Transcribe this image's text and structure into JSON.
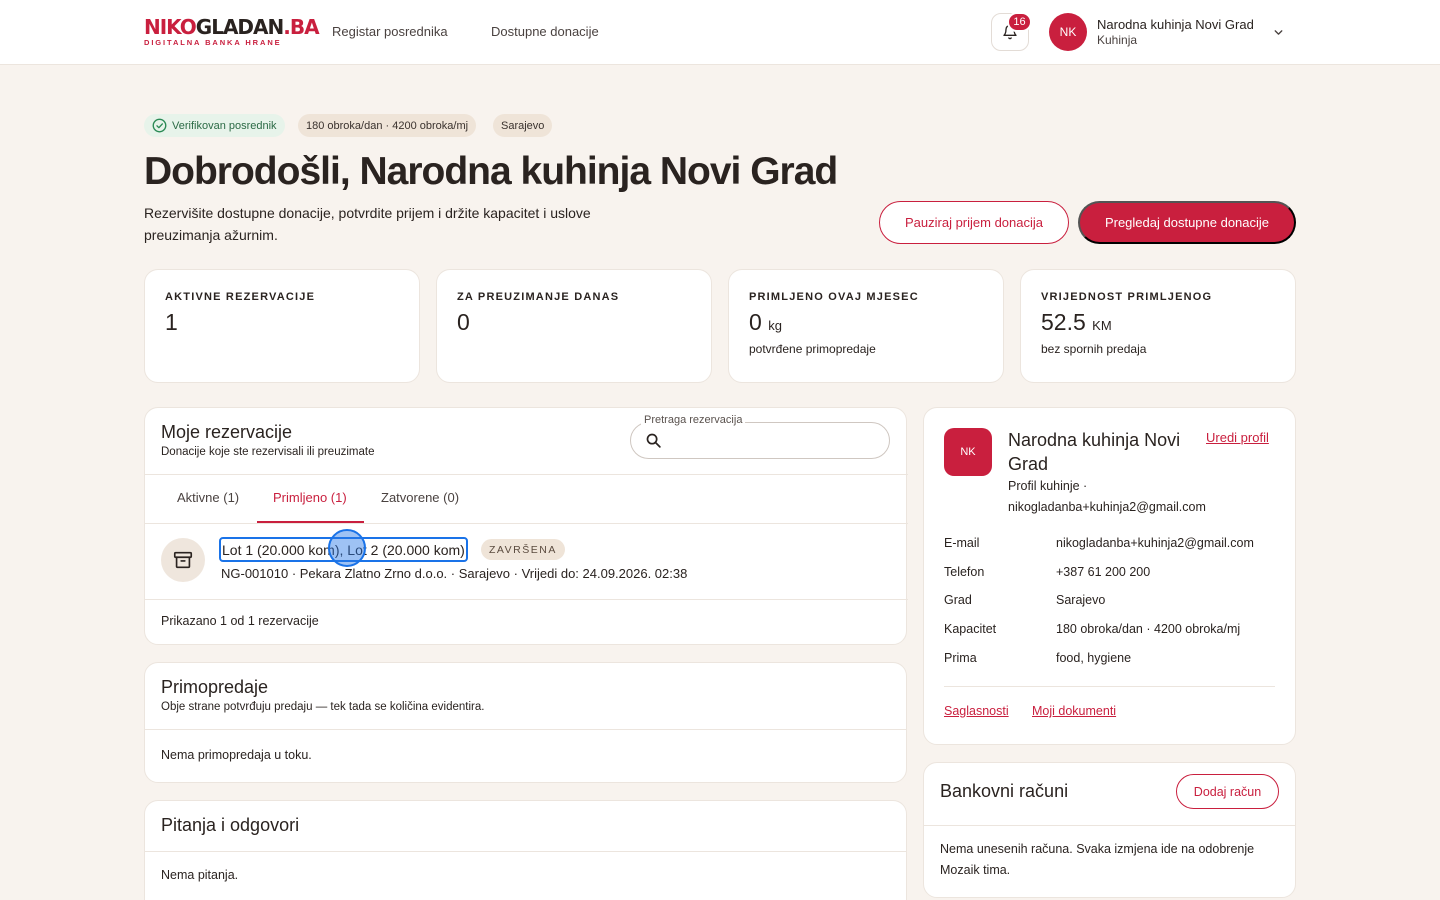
{
  "brand": {
    "logo_part1": "NIKO",
    "logo_part2": "GLADAN",
    "logo_part3": ".BA",
    "tagline": "DIGITALNA BANKA HRANE"
  },
  "nav": {
    "items": [
      "Registar posrednika",
      "Dostupne donacije"
    ]
  },
  "notifications": {
    "count": "16"
  },
  "user": {
    "initials": "NK",
    "name": "Narodna kuhinja Novi Grad",
    "role": "Kuhinja"
  },
  "chips": {
    "verified": "Verifikovan posrednik",
    "capacity": "180 obroka/dan · 4200 obroka/mj",
    "city": "Sarajevo"
  },
  "hero": {
    "title": "Dobrodošli, Narodna kuhinja Novi Grad",
    "subtitle": "Rezervišite dostupne donacije, potvrdite prijem i držite kapacitet i uslove preuzimanja ažurnim.",
    "pause_button": "Pauziraj prijem donacija",
    "browse_button": "Pregledaj dostupne donacije"
  },
  "stats": [
    {
      "label": "AKTIVNE REZERVACIJE",
      "value": "1",
      "unit": "",
      "note": ""
    },
    {
      "label": "ZA PREUZIMANJE DANAS",
      "value": "0",
      "unit": "",
      "note": ""
    },
    {
      "label": "PRIMLJENO OVAJ MJESEC",
      "value": "0",
      "unit": "kg",
      "note": "potvrđene primopredaje"
    },
    {
      "label": "VRIJEDNOST PRIMLJENOG",
      "value": "52.5",
      "unit": "KM",
      "note": "bez spornih predaja"
    }
  ],
  "reservations": {
    "title": "Moje rezervacije",
    "subtitle": "Donacije koje ste rezervisali ili preuzimate",
    "search_label": "Pretraga rezervacija",
    "search_value": "",
    "tabs": [
      "Aktivne (1)",
      "Primljeno (1)",
      "Zatvorene (0)"
    ],
    "active_tab": "Primljeno (1)",
    "items": [
      {
        "title": "Lot 1 (20.000 kom), Lot 2 (20.000 kom)",
        "status": "ZAVRŠENA",
        "meta": "NG-001010 · Pekara Zlatno Zrno d.o.o. · Sarajevo · Vrijedi do: 24.09.2026. 02:38"
      }
    ],
    "footer": "Prikazano 1 od 1 rezervacije"
  },
  "handovers": {
    "title": "Primopredaje",
    "subtitle": "Obje strane potvrđuju predaju — tek tada se količina evidentira.",
    "empty": "Nema primopredaja u toku."
  },
  "qa": {
    "title": "Pitanja i odgovori",
    "empty": "Nema pitanja."
  },
  "profile": {
    "initials": "NK",
    "name": "Narodna kuhinja Novi Grad",
    "edit_link": "Uredi profil",
    "subtitle": "Profil kuhinje · nikogladanba+kuhinja2@gmail.com",
    "rows": [
      {
        "label": "E-mail",
        "value": "nikogladanba+kuhinja2@gmail.com"
      },
      {
        "label": "Telefon",
        "value": "+387 61 200 200"
      },
      {
        "label": "Grad",
        "value": "Sarajevo"
      },
      {
        "label": "Kapacitet",
        "value": "180 obroka/dan · 4200 obroka/mj"
      },
      {
        "label": "Prima",
        "value": "food, hygiene"
      }
    ],
    "links": [
      "Saglasnosti",
      "Moji dokumenti"
    ]
  },
  "bank": {
    "title": "Bankovni računi",
    "add_button": "Dodaj račun",
    "empty": "Nema unesenih računa. Svaka izmjena ide na odobrenje Mozaik tima."
  },
  "colors": {
    "accent": "#c91f3e",
    "background": "#f8f3ee",
    "success": "#2b6a45",
    "focus": "#1a73e8"
  }
}
